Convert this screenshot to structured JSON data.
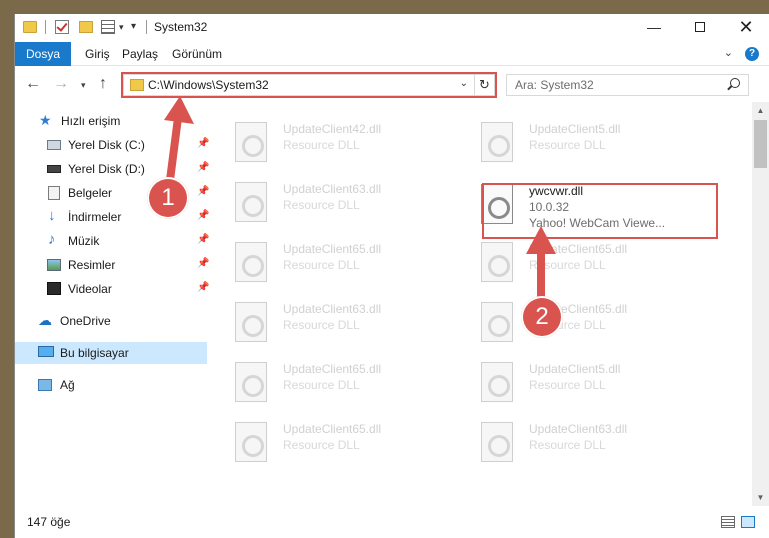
{
  "window": {
    "title": "System32"
  },
  "ribbon": {
    "tabs": [
      {
        "label": "Dosya"
      },
      {
        "label": "Giriş"
      },
      {
        "label": "Paylaş"
      },
      {
        "label": "Görünüm"
      }
    ]
  },
  "address": {
    "path": "C:\\Windows\\System32"
  },
  "search": {
    "placeholder": "Ara: System32"
  },
  "nav": {
    "quick_access": "Hızlı erişim",
    "items": [
      {
        "label": "Yerel Disk (C:)",
        "icon": "drive-icon"
      },
      {
        "label": "Yerel Disk (D:)",
        "icon": "drive-icon"
      },
      {
        "label": "Belgeler",
        "icon": "documents-icon"
      },
      {
        "label": "İndirmeler",
        "icon": "downloads-icon"
      },
      {
        "label": "Müzik",
        "icon": "music-icon"
      },
      {
        "label": "Resimler",
        "icon": "pictures-icon"
      },
      {
        "label": "Videolar",
        "icon": "videos-icon"
      }
    ],
    "onedrive": "OneDrive",
    "this_pc": "Bu bilgisayar",
    "network": "Ağ"
  },
  "files": {
    "left": [
      {
        "name": "UpdateClient42.dll",
        "type": "Resource DLL"
      },
      {
        "name": "UpdateClient63.dll",
        "type": "Resource DLL"
      },
      {
        "name": "UpdateClient65.dll",
        "type": "Resource DLL"
      },
      {
        "name": "UpdateClient63.dll",
        "type": "Resource DLL"
      },
      {
        "name": "UpdateClient65.dll",
        "type": "Resource DLL"
      },
      {
        "name": "UpdateClient65.dll",
        "type": "Resource DLL"
      }
    ],
    "right": [
      {
        "name": "UpdateClient5.dll",
        "type": "Resource DLL"
      },
      {
        "name": "UpdateClient65.dll",
        "type": "Resource DLL"
      },
      {
        "name": "UpdateClient65.dll",
        "type": "Resource DLL"
      },
      {
        "name": "UpdateClient5.dll",
        "type": "Resource DLL"
      },
      {
        "name": "UpdateClient63.dll",
        "type": "Resource DLL"
      }
    ],
    "focus": {
      "name": "ywcvwr.dll",
      "version": "10.0.32",
      "description": "Yahoo! WebCam Viewe..."
    }
  },
  "status": {
    "item_count": "147 öğe"
  },
  "callouts": {
    "one": "1",
    "two": "2"
  },
  "colors": {
    "accent": "#1979ca",
    "highlight": "#d9534f",
    "selection": "#cce8ff"
  }
}
